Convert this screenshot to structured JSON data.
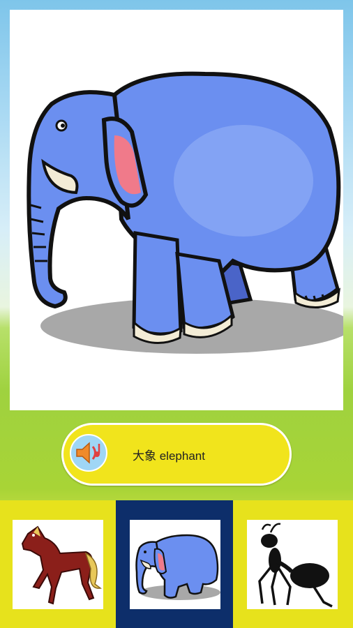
{
  "main": {
    "image_icon": "elephant-illustration"
  },
  "word": {
    "label": "大象 elephant",
    "speaker_icon": "speaker-sound-icon"
  },
  "choices": [
    {
      "icon": "horse-illustration",
      "selected": false
    },
    {
      "icon": "elephant-illustration",
      "selected": true
    },
    {
      "icon": "ant-illustration",
      "selected": false
    }
  ],
  "colors": {
    "pill": "#f1e41c",
    "strip": "#e7e21c",
    "selected_slot": "#0d2e6a",
    "elephant_body": "#6b8ff0"
  }
}
